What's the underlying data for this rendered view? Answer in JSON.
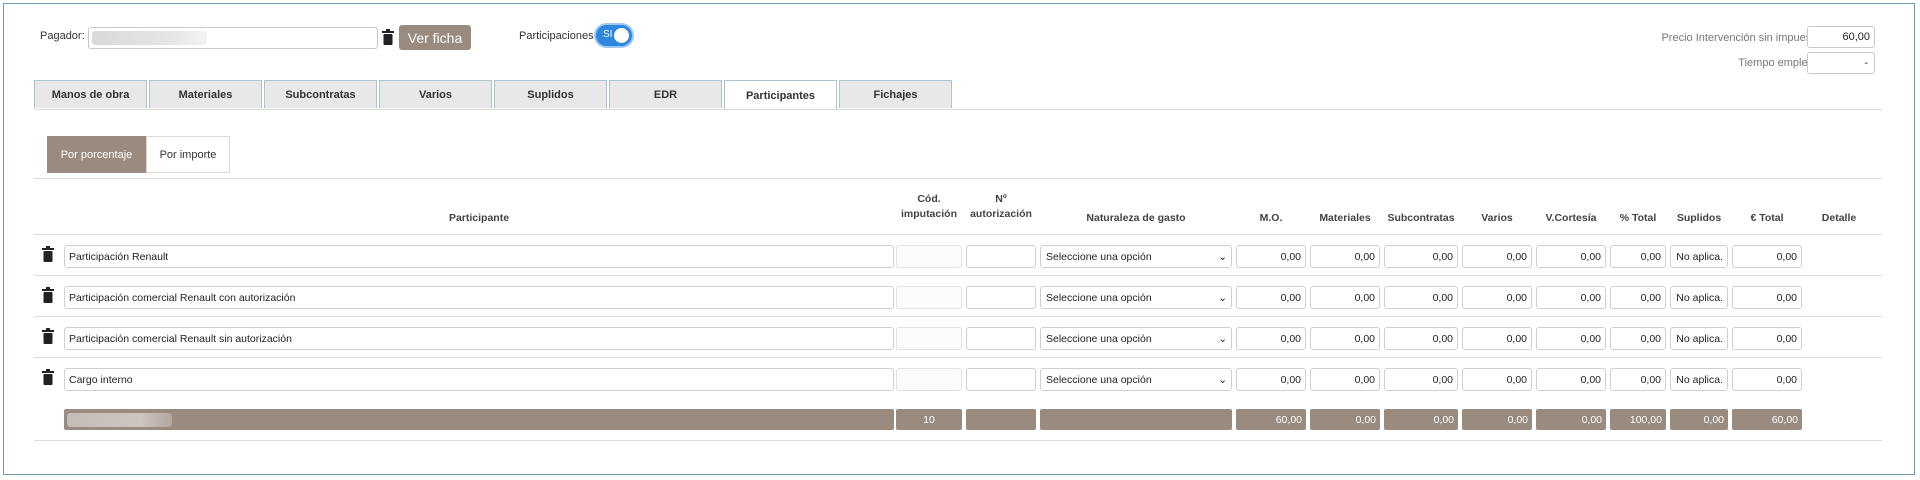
{
  "header": {
    "pagador_label": "Pagador:",
    "ver_ficha_label": "Ver ficha",
    "participaciones_label": "Participaciones:",
    "participaciones_toggle": "SI",
    "precio_label": "Precio Intervención sin impuestos:",
    "precio_value": "60,00",
    "tiempo_label": "Tiempo empleado:",
    "tiempo_value": "-"
  },
  "tabs": [
    {
      "label": "Manos de obra"
    },
    {
      "label": "Materiales"
    },
    {
      "label": "Subcontratas"
    },
    {
      "label": "Varios"
    },
    {
      "label": "Suplidos"
    },
    {
      "label": "EDR"
    },
    {
      "label": "Participantes",
      "active": true
    },
    {
      "label": "Fichajes"
    }
  ],
  "mode": {
    "porcentaje_label": "Por porcentaje",
    "importe_label": "Por importe",
    "selected": "Por porcentaje"
  },
  "table": {
    "headers": {
      "participante": "Participante",
      "cod_1": "Cód.",
      "cod_2": "imputación",
      "num_1": "Nº",
      "num_2": "autorización",
      "naturaleza": "Naturaleza de gasto",
      "mo": "M.O.",
      "materiales": "Materiales",
      "subcontratas": "Subcontratas",
      "varios": "Varios",
      "vcortesia": "V.Cortesía",
      "ptotal": "% Total",
      "suplidos": "Suplidos",
      "etotal": "€ Total",
      "detalle": "Detalle"
    },
    "rows": [
      {
        "participante": "Participación Renault",
        "naturaleza": "Seleccione una opción",
        "mo": "0,00",
        "materiales": "0,00",
        "subcontratas": "0,00",
        "varios": "0,00",
        "vcortesia": "0,00",
        "ptotal": "0,00",
        "suplidos": "No aplica.",
        "etotal": "0,00"
      },
      {
        "participante": "Participación comercial Renault con autorización",
        "naturaleza": "Seleccione una opción",
        "mo": "0,00",
        "materiales": "0,00",
        "subcontratas": "0,00",
        "varios": "0,00",
        "vcortesia": "0,00",
        "ptotal": "0,00",
        "suplidos": "No aplica.",
        "etotal": "0,00"
      },
      {
        "participante": "Participación comercial Renault sin autorización",
        "naturaleza": "Seleccione una opción",
        "mo": "0,00",
        "materiales": "0,00",
        "subcontratas": "0,00",
        "varios": "0,00",
        "vcortesia": "0,00",
        "ptotal": "0,00",
        "suplidos": "No aplica.",
        "etotal": "0,00"
      },
      {
        "participante": "Cargo interno",
        "naturaleza": "Seleccione una opción",
        "mo": "0,00",
        "materiales": "0,00",
        "subcontratas": "0,00",
        "varios": "0,00",
        "vcortesia": "0,00",
        "ptotal": "0,00",
        "suplidos": "No aplica.",
        "etotal": "0,00"
      }
    ],
    "totals": {
      "cod": "10",
      "mo": "60,00",
      "materiales": "0,00",
      "subcontratas": "0,00",
      "varios": "0,00",
      "vcortesia": "0,00",
      "ptotal": "100,00",
      "suplidos": "0,00",
      "etotal": "60,00"
    }
  },
  "colors": {
    "accent": "#9a8b80",
    "toggle": "#2f86e0",
    "tab_border": "#a9c3d2"
  }
}
